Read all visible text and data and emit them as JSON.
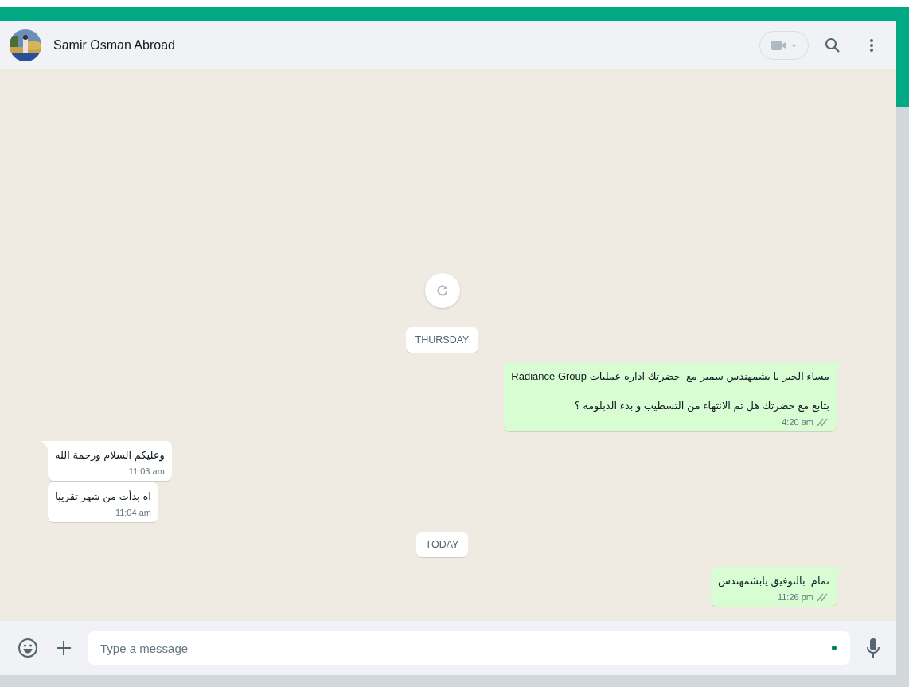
{
  "header": {
    "contact_name": "Samir Osman Abroad"
  },
  "messages": [
    {
      "kind": "loader"
    },
    {
      "kind": "date",
      "label": "THURSDAY"
    },
    {
      "kind": "message",
      "outgoing": true,
      "paragraphs": [
        "مساء الخير يا بشمهندس سمير مع  حضرتك اداره عمليات Radiance Group",
        "بتابع مع حضرتك هل تم الانتهاء من التسطيب و بدء الدبلومه ؟"
      ],
      "time": "4:20 am",
      "read": false,
      "tail": true
    },
    {
      "kind": "message",
      "outgoing": false,
      "paragraphs": [
        "وعليكم السلام ورحمة الله"
      ],
      "time": "11:03 am",
      "tail": true
    },
    {
      "kind": "message",
      "outgoing": false,
      "paragraphs": [
        "اه بدأت من شهر تقريبا"
      ],
      "time": "11:04 am",
      "tail": false
    },
    {
      "kind": "date",
      "label": "TODAY"
    },
    {
      "kind": "message",
      "outgoing": true,
      "paragraphs": [
        "تمام  بالتوفيق يابشمهندس"
      ],
      "time": "11:26 pm",
      "read": false,
      "tail": true
    }
  ],
  "composer": {
    "placeholder": "Type a message"
  }
}
